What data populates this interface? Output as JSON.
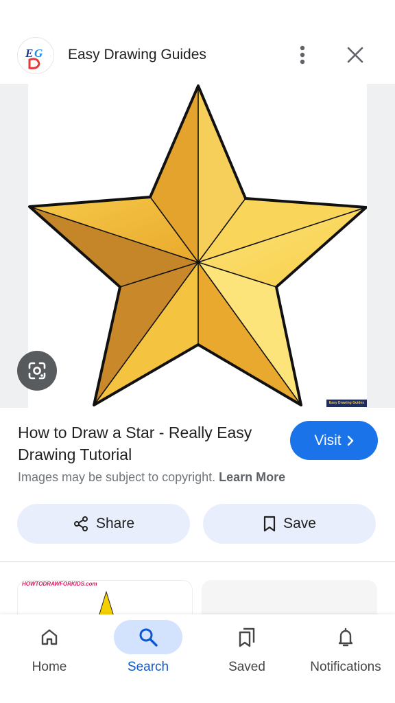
{
  "header": {
    "logo_text": "EG",
    "site_name": "Easy Drawing Guides",
    "more_icon": "more-vert-icon",
    "close_icon": "close-icon"
  },
  "image": {
    "watermark": "Easy Drawing Guides",
    "lens_icon": "google-lens-icon"
  },
  "result": {
    "title": "How to Draw a Star - Really Easy Drawing Tutorial",
    "visit_label": "Visit",
    "copyright_text": "Images may be subject to copyright.",
    "learn_more": "Learn More"
  },
  "actions": {
    "share_label": "Share",
    "save_label": "Save"
  },
  "related": {
    "card1_site": "HOWTODRAWFORKIDS.com"
  },
  "nav": {
    "items": [
      {
        "label": "Home",
        "icon": "home-icon"
      },
      {
        "label": "Search",
        "icon": "search-icon",
        "active": true
      },
      {
        "label": "Saved",
        "icon": "bookmarks-icon"
      },
      {
        "label": "Notifications",
        "icon": "bell-icon"
      }
    ]
  },
  "colors": {
    "accent": "#1a73e8",
    "pill_bg": "#e8eefb",
    "nav_active_bg": "#d3e3fd",
    "star_gold": "#f2c94c"
  }
}
